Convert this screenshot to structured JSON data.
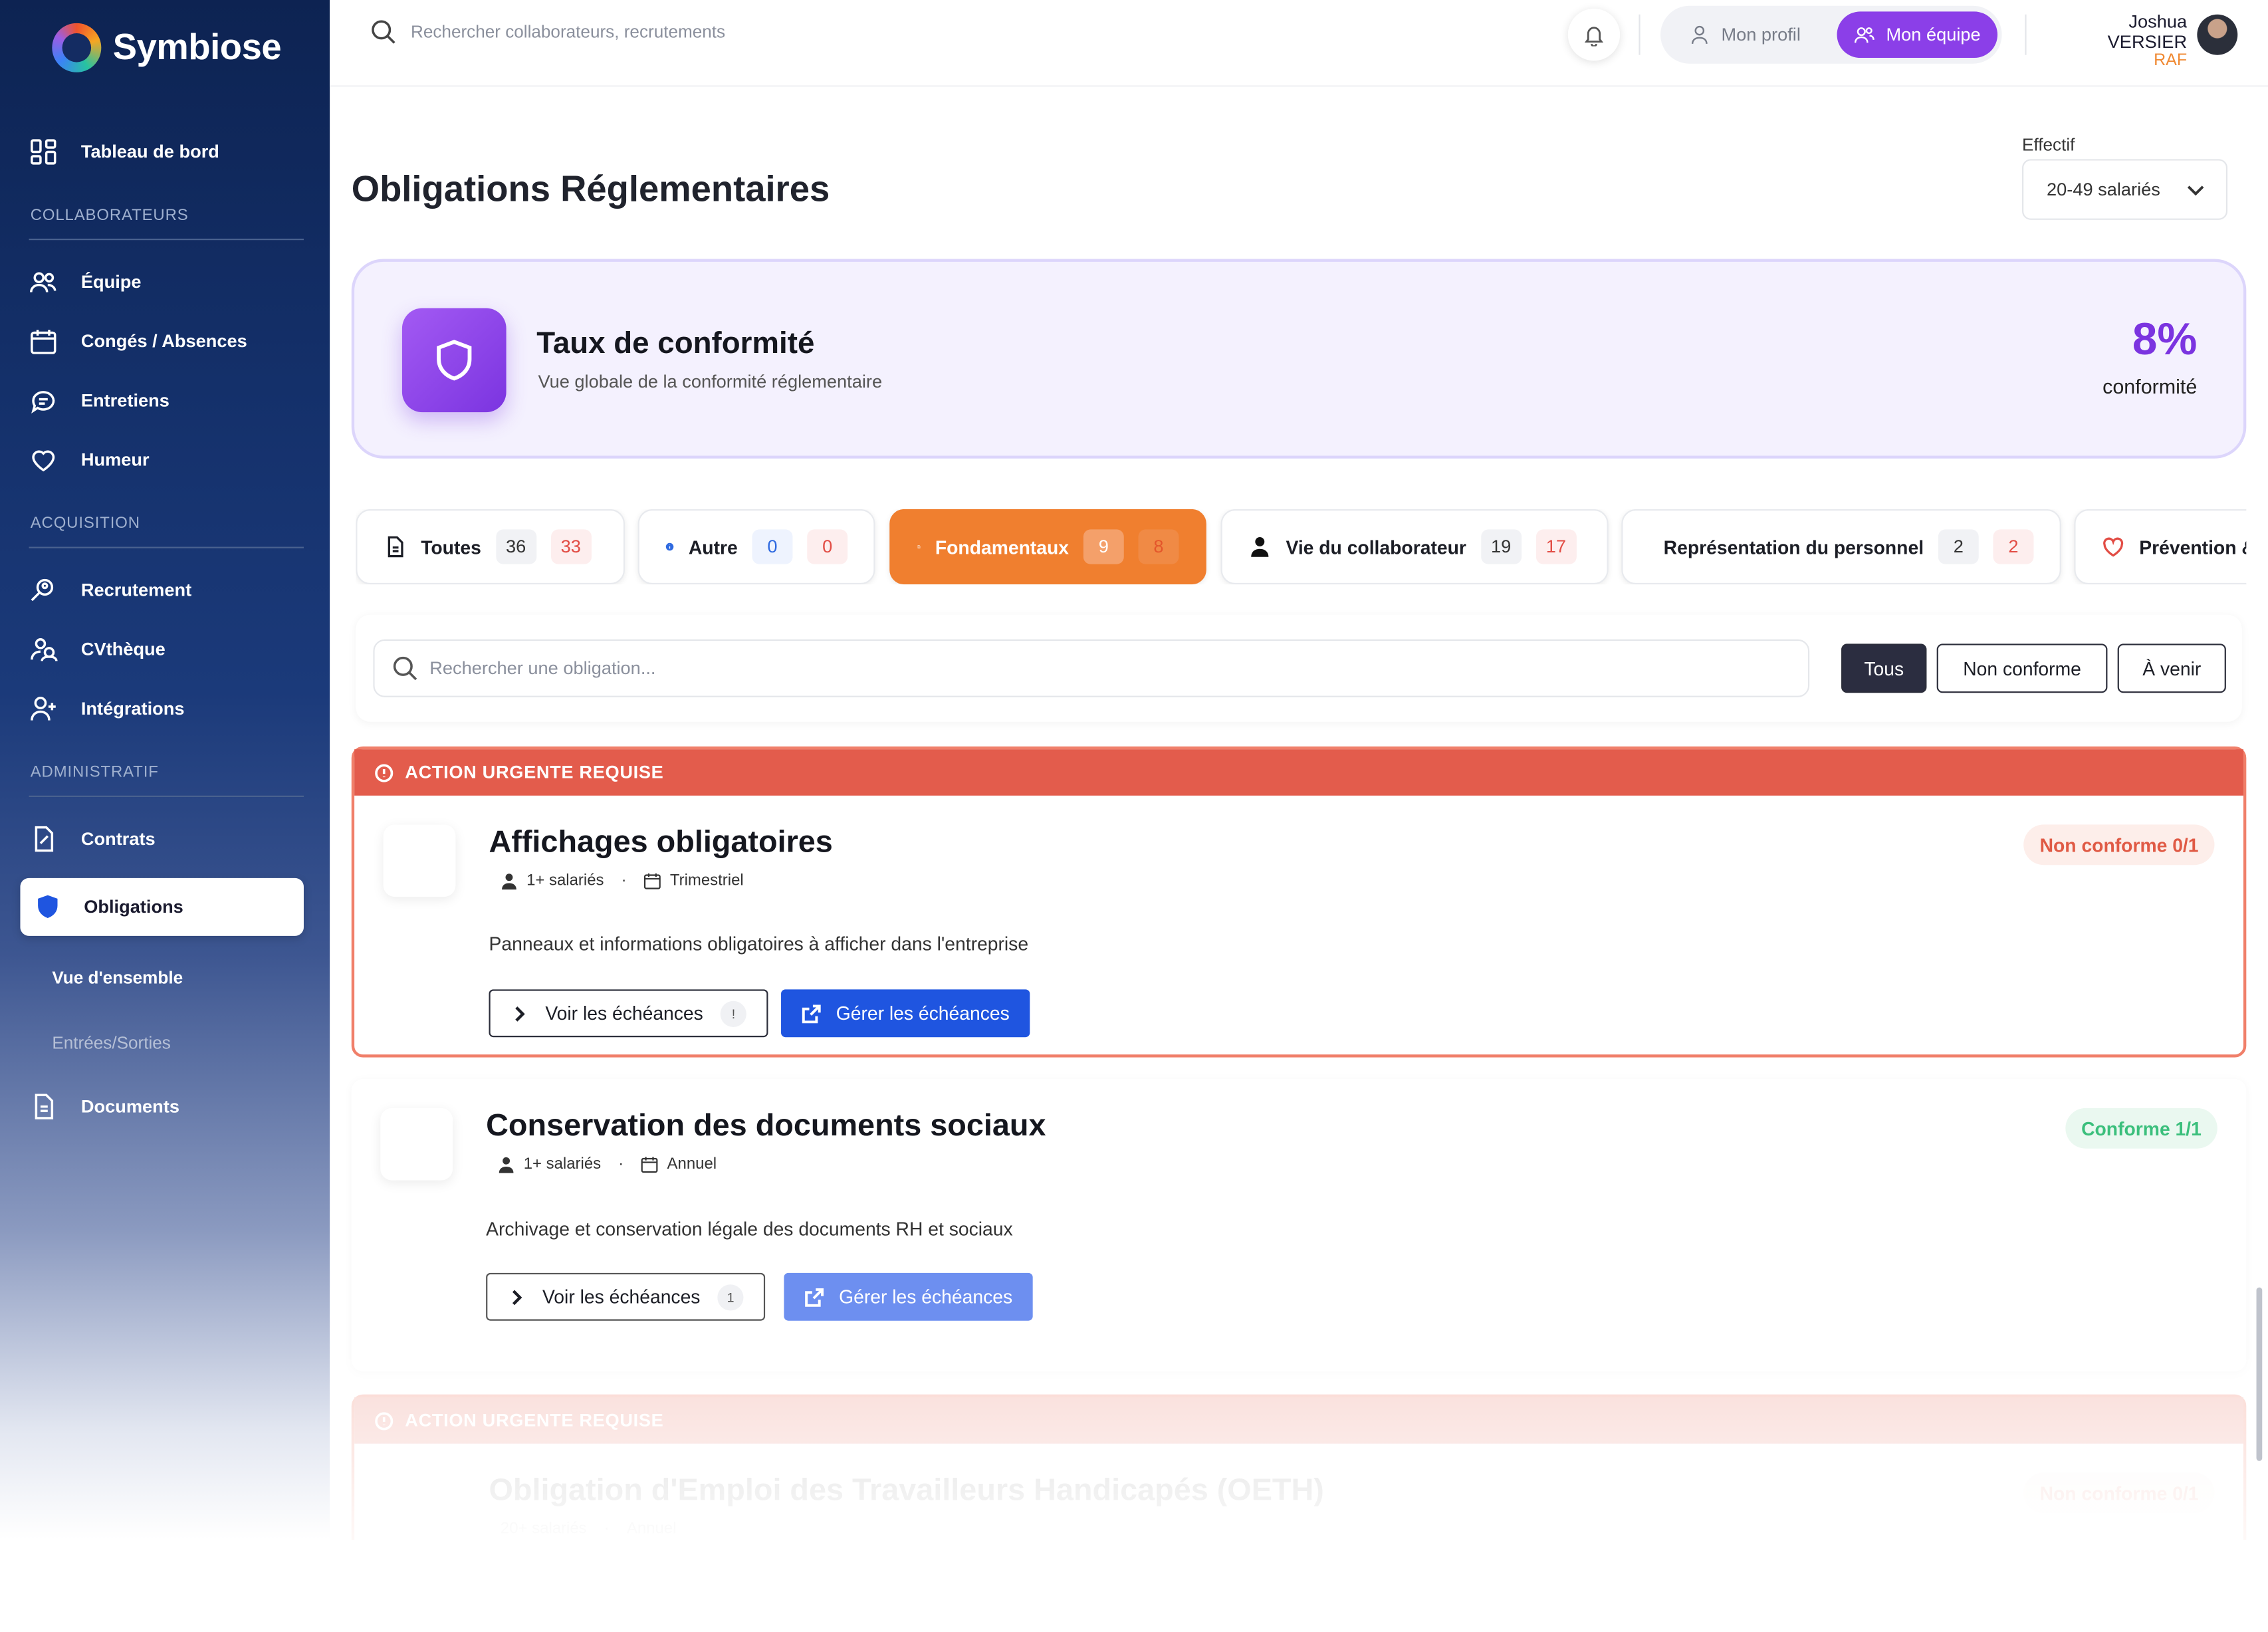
{
  "app": {
    "name": "Symbiose"
  },
  "sidebar": {
    "dashboard": "Tableau de bord",
    "sections": {
      "collaborateurs": "COLLABORATEURS",
      "acquisition": "ACQUISITION",
      "administratif": "ADMINISTRATIF"
    },
    "items": {
      "equipe": "Équipe",
      "conges": "Congés / Absences",
      "entretiens": "Entretiens",
      "humeur": "Humeur",
      "recrutement": "Recrutement",
      "cvtheque": "CVthèque",
      "integrations": "Intégrations",
      "contrats": "Contrats",
      "obligations": "Obligations",
      "vue_ensemble": "Vue d'ensemble",
      "entrees_sorties": "Entrées/Sorties",
      "documents": "Documents"
    }
  },
  "header": {
    "search_placeholder": "Rechercher collaborateurs, recrutements",
    "mon_profil": "Mon profil",
    "mon_equipe": "Mon équipe",
    "user_name": "Joshua VERSIER",
    "user_role": "RAF"
  },
  "page": {
    "title": "Obligations Réglementaires",
    "effectif_label": "Effectif",
    "effectif_value": "20-49 salariés"
  },
  "conformite": {
    "title": "Taux de conformité",
    "subtitle": "Vue globale de la conformité réglementaire",
    "percent": "8%",
    "percent_label": "conformité"
  },
  "tabs": [
    {
      "label": "Toutes",
      "count": "36",
      "alert": "33"
    },
    {
      "label": "Autre",
      "count": "0",
      "alert": "0"
    },
    {
      "label": "Fondamentaux",
      "count": "9",
      "alert": "8"
    },
    {
      "label": "Vie du collaborateur",
      "count": "19",
      "alert": "17"
    },
    {
      "label": "Représentation du personnel",
      "count": "2",
      "alert": "2"
    },
    {
      "label": "Prévention &"
    }
  ],
  "filters": {
    "search_placeholder": "Rechercher une obligation...",
    "tous": "Tous",
    "non_conforme": "Non conforme",
    "a_venir": "À venir"
  },
  "obligations": [
    {
      "urgent_label": "ACTION URGENTE REQUISE",
      "title": "Affichages obligatoires",
      "salaries": "1+ salariés",
      "frequency": "Trimestriel",
      "description": "Panneaux et informations obligatoires à afficher dans l'entreprise",
      "status": "Non conforme 0/1",
      "voir": "Voir les échéances",
      "voir_count": "!",
      "gerer": "Gérer les échéances"
    },
    {
      "title": "Conservation des documents sociaux",
      "salaries": "1+ salariés",
      "frequency": "Annuel",
      "description": "Archivage et conservation légale des documents RH et sociaux",
      "status": "Conforme 1/1",
      "voir": "Voir les échéances",
      "voir_count": "1",
      "gerer": "Gérer les échéances"
    },
    {
      "urgent_label": "ACTION URGENTE REQUISE",
      "title": "Obligation d'Emploi des Travailleurs Handicapés (OETH)",
      "salaries": "20+ salariés",
      "frequency": "Annuel",
      "status": "Non conforme 0/1"
    }
  ],
  "colors": {
    "accent_purple": "#8b3fe8",
    "accent_orange": "#f07f2f",
    "urgent_red": "#e35c4c",
    "primary_blue": "#1f55e0",
    "sidebar_navy": "#0d2352"
  }
}
